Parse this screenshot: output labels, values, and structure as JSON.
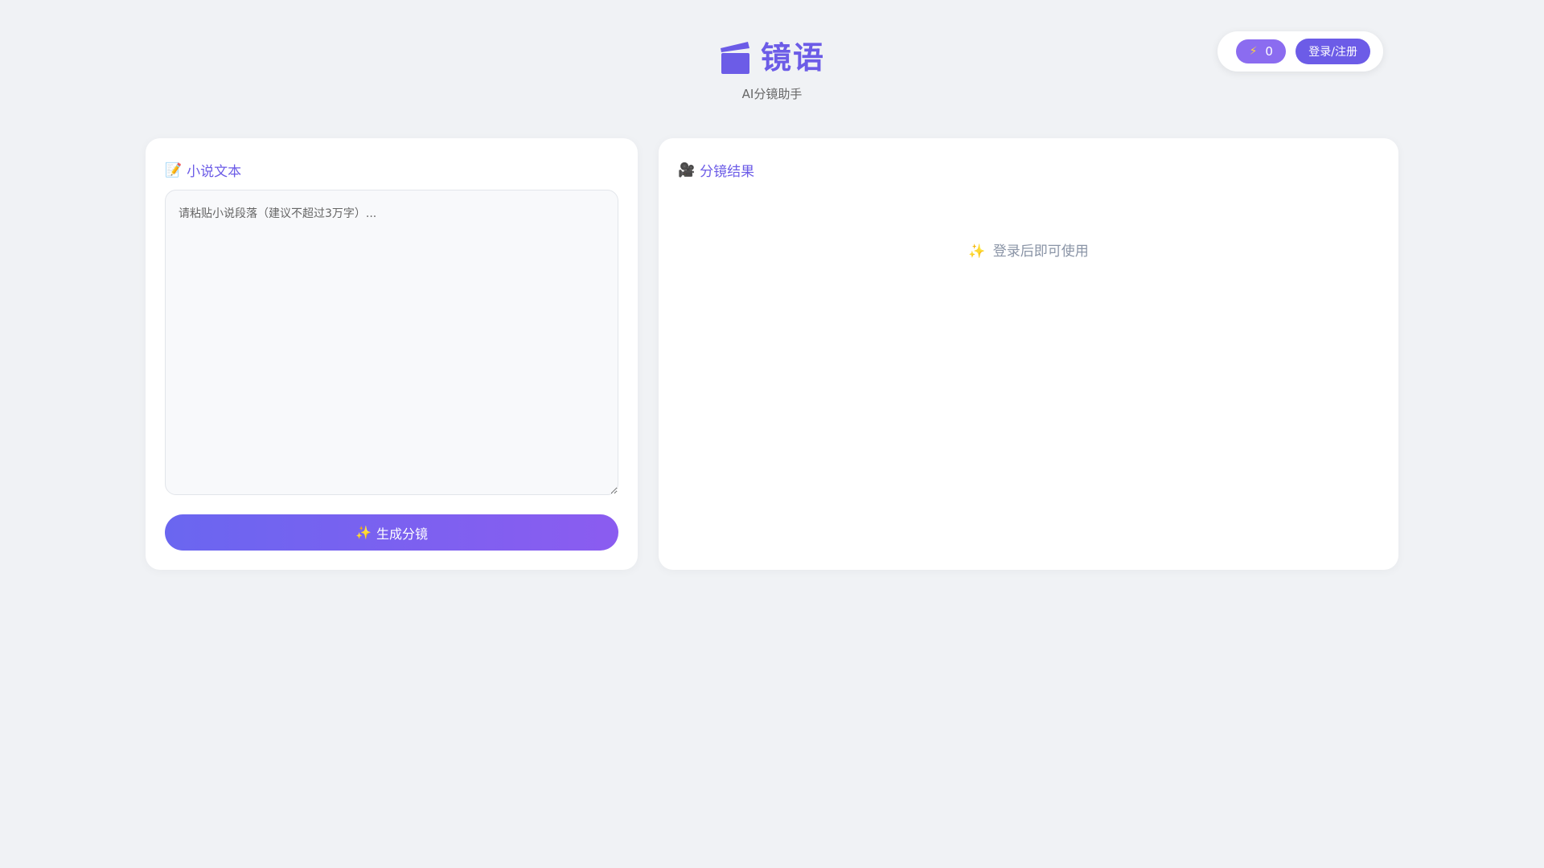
{
  "app": {
    "title": "镜语",
    "subtitle": "AI分镜助手",
    "icon": "clapperboard-icon",
    "accent_color": "#6c5ce7"
  },
  "user_bar": {
    "credits_icon": "lightning-icon",
    "credits_value": "0",
    "login_label": "登录/注册"
  },
  "input_panel": {
    "title_icon": "memo-icon",
    "title": "小说文本",
    "placeholder": "请粘贴小说段落（建议不超过3万字）...",
    "value": "",
    "generate_icon": "sparkle-icon",
    "generate_label": "生成分镜"
  },
  "result_panel": {
    "title_icon": "camera-icon",
    "title": "分镜结果",
    "empty_icon": "sparkle-icon",
    "empty_text": "登录后即可使用"
  }
}
